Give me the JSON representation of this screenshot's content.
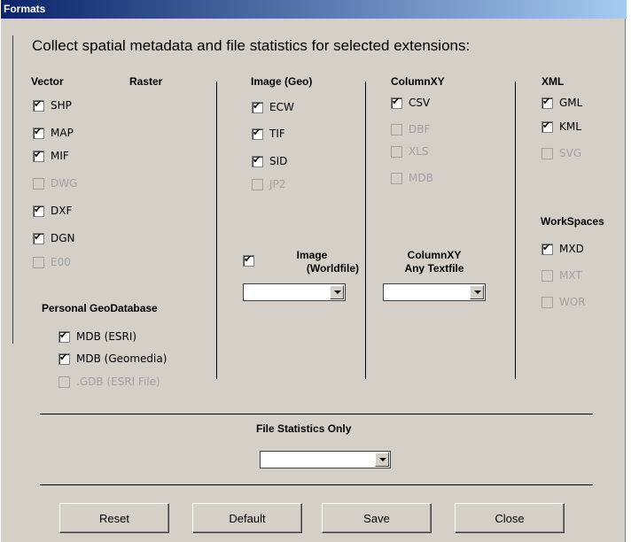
{
  "window": {
    "title": "Formats"
  },
  "heading": "Collect spatial metadata and file statistics for selected extensions:",
  "columns": {
    "vector": "Vector",
    "raster": "Raster",
    "image_geo": "Image (Geo)",
    "columnxy": "ColumnXY",
    "xml": "XML",
    "workspaces": "WorkSpaces"
  },
  "vector_items": [
    {
      "label": "SHP",
      "checked": true,
      "enabled": true
    },
    {
      "label": "MAP",
      "checked": true,
      "enabled": true
    },
    {
      "label": "MIF",
      "checked": true,
      "enabled": true
    },
    {
      "label": "DWG",
      "checked": false,
      "enabled": false
    },
    {
      "label": "DXF",
      "checked": true,
      "enabled": true
    },
    {
      "label": "DGN",
      "checked": true,
      "enabled": true
    },
    {
      "label": "E00",
      "checked": false,
      "enabled": false
    }
  ],
  "image_items": [
    {
      "label": "ECW",
      "checked": true,
      "enabled": true
    },
    {
      "label": "TIF",
      "checked": true,
      "enabled": true
    },
    {
      "label": "SID",
      "checked": true,
      "enabled": true
    },
    {
      "label": "JP2",
      "checked": false,
      "enabled": false
    }
  ],
  "columnxy_items": [
    {
      "label": "CSV",
      "checked": true,
      "enabled": true
    },
    {
      "label": "DBF",
      "checked": false,
      "enabled": false
    },
    {
      "label": "XLS",
      "checked": false,
      "enabled": false
    },
    {
      "label": "MDB",
      "checked": false,
      "enabled": false
    }
  ],
  "xml_items": [
    {
      "label": "GML",
      "checked": true,
      "enabled": true
    },
    {
      "label": "KML",
      "checked": true,
      "enabled": true
    },
    {
      "label": "SVG",
      "checked": false,
      "enabled": false
    }
  ],
  "workspace_items": [
    {
      "label": "MXD",
      "checked": true,
      "enabled": true
    },
    {
      "label": "MXT",
      "checked": false,
      "enabled": false
    },
    {
      "label": "WOR",
      "checked": false,
      "enabled": false
    }
  ],
  "personal_geodatabase": {
    "title": "Personal GeoDatabase",
    "items": [
      {
        "label": "MDB (ESRI)",
        "checked": true,
        "enabled": true
      },
      {
        "label": "MDB (Geomedia)",
        "checked": true,
        "enabled": true
      },
      {
        "label": ".GDB (ESRI File)",
        "checked": false,
        "enabled": false
      }
    ]
  },
  "image_worldfile": {
    "label_line1": "Image",
    "label_line2": "(Worldfile)",
    "checked": true,
    "select_value": ""
  },
  "columnxy_any": {
    "label_line1": "ColumnXY",
    "label_line2": "Any Textfile",
    "select_value": ""
  },
  "file_statistics": {
    "label": "File Statistics Only",
    "select_value": ""
  },
  "buttons": {
    "reset": "Reset",
    "default": "Default",
    "save": "Save",
    "close": "Close"
  }
}
